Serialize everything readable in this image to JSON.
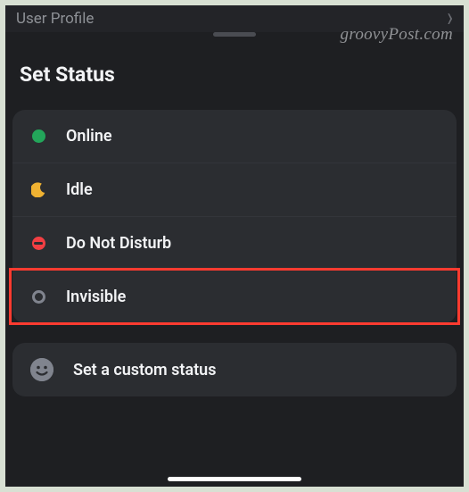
{
  "header": {
    "back_label": "User Profile"
  },
  "watermark": "groovyPost.com",
  "sheet": {
    "title": "Set Status"
  },
  "status_options": [
    {
      "key": "online",
      "label": "Online"
    },
    {
      "key": "idle",
      "label": "Idle"
    },
    {
      "key": "dnd",
      "label": "Do Not Disturb"
    },
    {
      "key": "invisible",
      "label": "Invisible"
    }
  ],
  "custom_status": {
    "label": "Set a custom status"
  },
  "highlighted_option": "invisible",
  "colors": {
    "online": "#23a55a",
    "idle": "#f0b232",
    "dnd": "#f23f43",
    "invisible": "#80848e",
    "highlight": "#ff3b30"
  }
}
